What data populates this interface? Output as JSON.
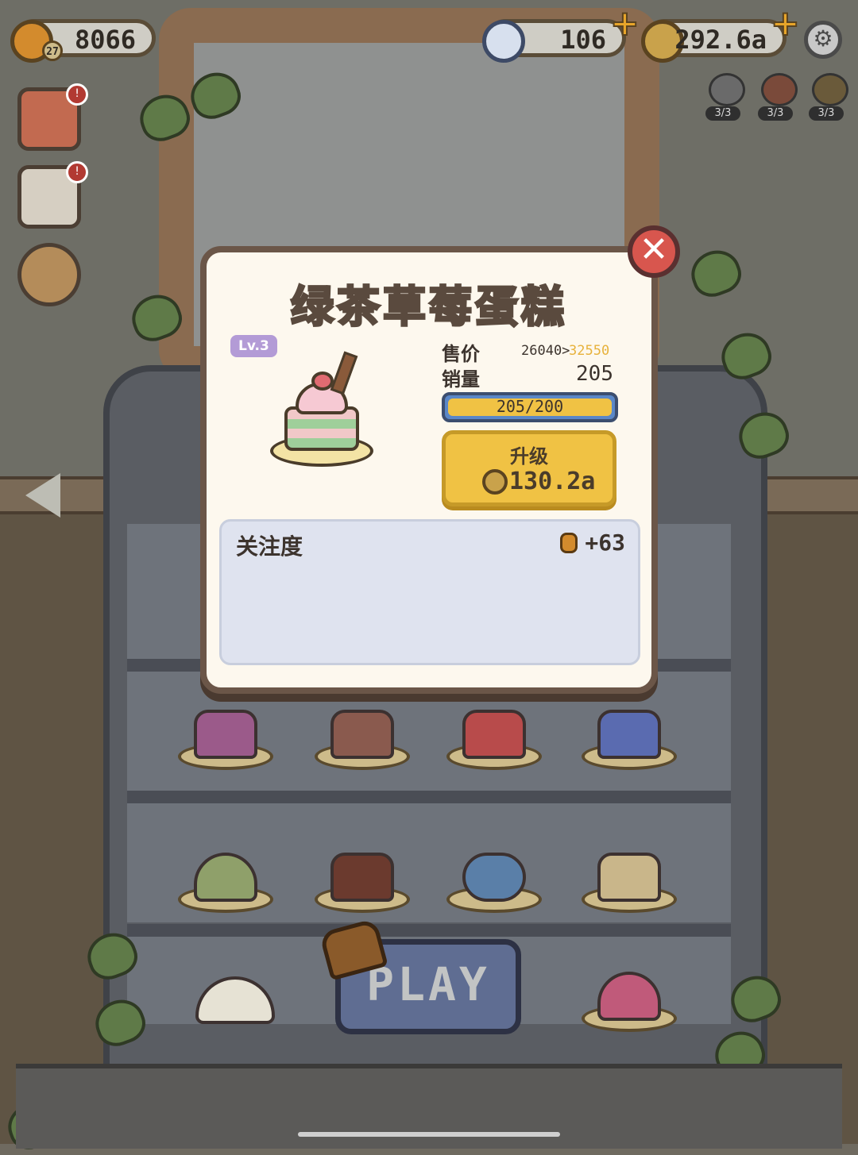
{
  "hud": {
    "fish_count": "8066",
    "level_badge": "27",
    "gems": "106",
    "coins": "292.6a"
  },
  "boosters": [
    {
      "name": "booster-1",
      "label": "3/3"
    },
    {
      "name": "booster-2",
      "label": "3/3"
    },
    {
      "name": "booster-3",
      "label": "3/3"
    }
  ],
  "sidebar": {
    "badge_1": "!",
    "badge_2": "!"
  },
  "modal": {
    "title": "绿茶草莓蛋糕",
    "level": "Lv.3",
    "price_label": "售价",
    "price_old": "26040>",
    "price_new": "32550",
    "sales_label": "销量",
    "sales_value": "205",
    "progress_text": "205/200",
    "upgrade_label": "升级",
    "upgrade_cost": "130.2a",
    "attention_label": "关注度",
    "attention_value": "+63",
    "close": "✕"
  },
  "play_button": "PLAY",
  "colors": {
    "accent_yellow": "#f0c244",
    "modal_bg": "#fdf8ee",
    "close_red": "#d8564e",
    "progress_blue": "#5a87c7"
  }
}
